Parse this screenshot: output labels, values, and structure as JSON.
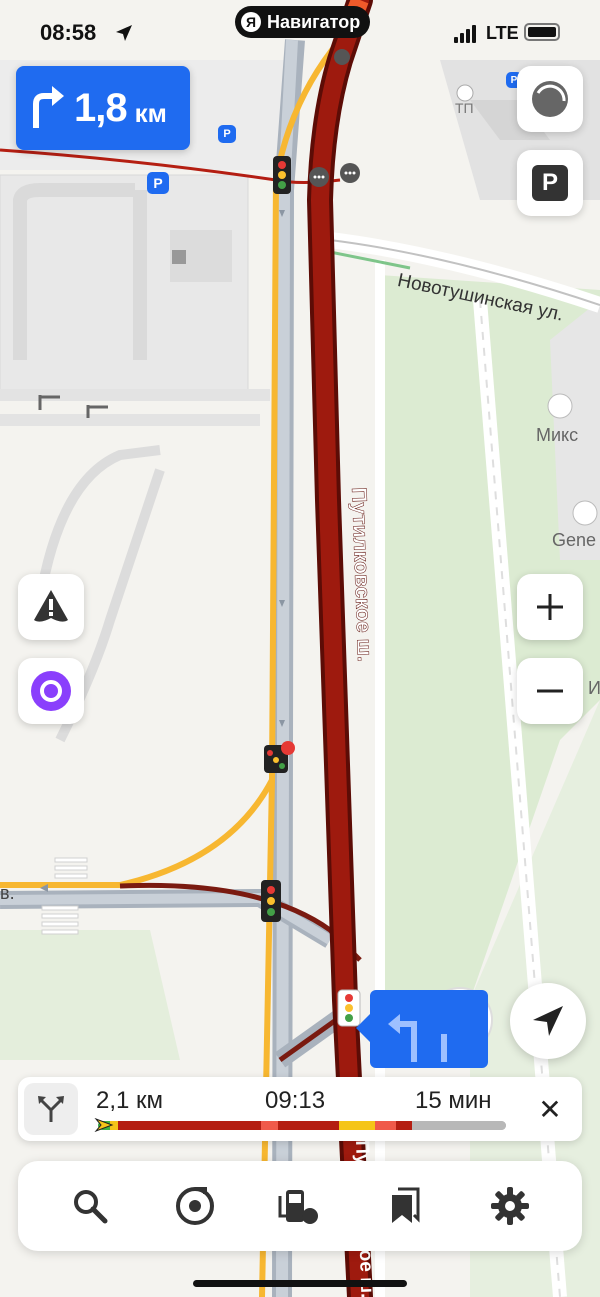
{
  "status_bar": {
    "time": "08:58",
    "app_name": "Навигатор",
    "app_logo_letter": "Я",
    "network": "LTE"
  },
  "maneuver": {
    "distance": "1,8",
    "unit": "км",
    "direction_icon": "turn-right-icon"
  },
  "map": {
    "street_1": "Новотушинская ул.",
    "street_2": "Путилковское ш.",
    "street_3": "Путилковское ш.",
    "poi_1": "Микс",
    "poi_2": "Gene",
    "poi_3": "ТП",
    "partial_label_1": "в.",
    "partial_label_2": "И",
    "parking_letter": "P"
  },
  "route": {
    "remaining_distance": "2,1 км",
    "arrival_time": "09:13",
    "duration": "15 мин",
    "close_label": "✕",
    "traffic_segments": [
      {
        "color": "#3cb043",
        "share": 0.03
      },
      {
        "color": "#f5c518",
        "share": 0.02
      },
      {
        "color": "#b41e12",
        "share": 0.35
      },
      {
        "color": "#f05a4a",
        "share": 0.04
      },
      {
        "color": "#b41e12",
        "share": 0.15
      },
      {
        "color": "#f5c518",
        "share": 0.09
      },
      {
        "color": "#f05a4a",
        "share": 0.05
      },
      {
        "color": "#b41e12",
        "share": 0.04
      },
      {
        "color": "#b8b8b8",
        "share": 0.23
      }
    ]
  },
  "toolbar": {
    "items": [
      "search-icon",
      "music-icon",
      "gas-station-icon",
      "bookmarks-icon",
      "settings-icon"
    ]
  },
  "colors": {
    "accent": "#1f6bf0",
    "traffic_jam": "#b41e12",
    "road_yellow": "#f7b731",
    "park_green": "#dcebd2"
  }
}
